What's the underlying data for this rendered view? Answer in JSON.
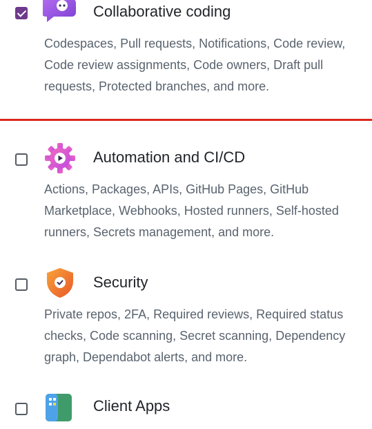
{
  "features": [
    {
      "id": "collab",
      "checked": true,
      "icon": "collaborative-coding-icon",
      "title": "Collaborative coding",
      "description": "Codespaces, Pull requests, Notifications, Code review, Code review assignments, Code owners, Draft pull requests, Protected branches, and more."
    },
    {
      "id": "automation",
      "checked": false,
      "icon": "automation-gear-icon",
      "title": "Automation and CI/CD",
      "description": "Actions, Packages, APIs, GitHub Pages, GitHub Marketplace, Webhooks, Hosted runners, Self-hosted runners, Secrets management, and more."
    },
    {
      "id": "security",
      "checked": false,
      "icon": "security-shield-icon",
      "title": "Security",
      "description": "Private repos, 2FA, Required reviews, Required status checks, Code scanning, Secret scanning, Dependency graph, Dependabot alerts, and more."
    },
    {
      "id": "client-apps",
      "checked": false,
      "icon": "client-apps-icon",
      "title": "Client Apps",
      "description": ""
    }
  ],
  "colors": {
    "accent": "#6e3a8c",
    "divider": "#d9281d",
    "title": "#1f2328",
    "description": "#59636e"
  }
}
